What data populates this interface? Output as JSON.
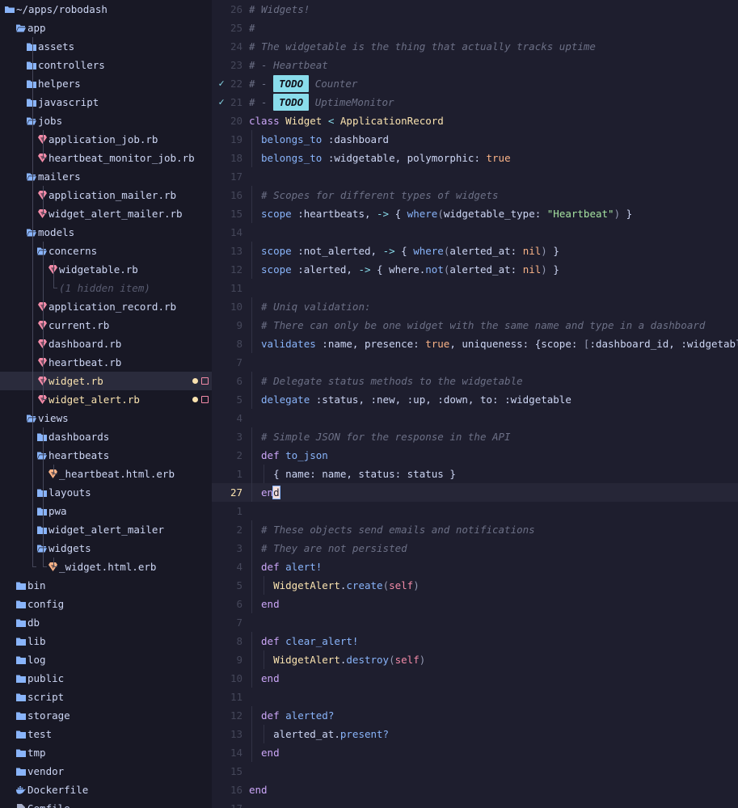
{
  "sidebar": {
    "root_label": "~/apps/robodash",
    "rows": [
      {
        "label": "app",
        "depth": 1,
        "kind": "folder-open"
      },
      {
        "label": "assets",
        "depth": 2,
        "kind": "folder"
      },
      {
        "label": "controllers",
        "depth": 2,
        "kind": "folder"
      },
      {
        "label": "helpers",
        "depth": 2,
        "kind": "folder"
      },
      {
        "label": "javascript",
        "depth": 2,
        "kind": "folder"
      },
      {
        "label": "jobs",
        "depth": 2,
        "kind": "folder-open"
      },
      {
        "label": "application_job.rb",
        "depth": 3,
        "kind": "ruby"
      },
      {
        "label": "heartbeat_monitor_job.rb",
        "depth": 3,
        "kind": "ruby"
      },
      {
        "label": "mailers",
        "depth": 2,
        "kind": "folder-open"
      },
      {
        "label": "application_mailer.rb",
        "depth": 3,
        "kind": "ruby"
      },
      {
        "label": "widget_alert_mailer.rb",
        "depth": 3,
        "kind": "ruby"
      },
      {
        "label": "models",
        "depth": 2,
        "kind": "folder-open"
      },
      {
        "label": "concerns",
        "depth": 3,
        "kind": "folder-open"
      },
      {
        "label": "widgetable.rb",
        "depth": 4,
        "kind": "ruby"
      },
      {
        "label": "(1 hidden item)",
        "depth": 4,
        "kind": "hidden"
      },
      {
        "label": "application_record.rb",
        "depth": 3,
        "kind": "ruby"
      },
      {
        "label": "current.rb",
        "depth": 3,
        "kind": "ruby"
      },
      {
        "label": "dashboard.rb",
        "depth": 3,
        "kind": "ruby"
      },
      {
        "label": "heartbeat.rb",
        "depth": 3,
        "kind": "ruby"
      },
      {
        "label": "widget.rb",
        "depth": 3,
        "kind": "ruby",
        "modified": true,
        "active": true
      },
      {
        "label": "widget_alert.rb",
        "depth": 3,
        "kind": "ruby",
        "modified": true
      },
      {
        "label": "views",
        "depth": 2,
        "kind": "folder-open"
      },
      {
        "label": "dashboards",
        "depth": 3,
        "kind": "folder"
      },
      {
        "label": "heartbeats",
        "depth": 3,
        "kind": "folder-open"
      },
      {
        "label": "_heartbeat.html.erb",
        "depth": 4,
        "kind": "erb"
      },
      {
        "label": "layouts",
        "depth": 3,
        "kind": "folder"
      },
      {
        "label": "pwa",
        "depth": 3,
        "kind": "folder"
      },
      {
        "label": "widget_alert_mailer",
        "depth": 3,
        "kind": "folder"
      },
      {
        "label": "widgets",
        "depth": 3,
        "kind": "folder-open"
      },
      {
        "label": "_widget.html.erb",
        "depth": 4,
        "kind": "erb"
      },
      {
        "label": "bin",
        "depth": 1,
        "kind": "folder"
      },
      {
        "label": "config",
        "depth": 1,
        "kind": "folder"
      },
      {
        "label": "db",
        "depth": 1,
        "kind": "folder"
      },
      {
        "label": "lib",
        "depth": 1,
        "kind": "folder"
      },
      {
        "label": "log",
        "depth": 1,
        "kind": "folder"
      },
      {
        "label": "public",
        "depth": 1,
        "kind": "folder"
      },
      {
        "label": "script",
        "depth": 1,
        "kind": "folder"
      },
      {
        "label": "storage",
        "depth": 1,
        "kind": "folder"
      },
      {
        "label": "test",
        "depth": 1,
        "kind": "folder"
      },
      {
        "label": "tmp",
        "depth": 1,
        "kind": "folder"
      },
      {
        "label": "vendor",
        "depth": 1,
        "kind": "folder"
      },
      {
        "label": "Dockerfile",
        "depth": 1,
        "kind": "docker"
      },
      {
        "label": "Gemfile",
        "depth": 1,
        "kind": "file"
      }
    ]
  },
  "editor": {
    "lines": [
      {
        "num": "26",
        "indent": 0,
        "tokens": [
          [
            "comment",
            "# Widgets!"
          ]
        ]
      },
      {
        "num": "25",
        "indent": 0,
        "tokens": [
          [
            "comment",
            "#"
          ]
        ]
      },
      {
        "num": "24",
        "indent": 0,
        "tokens": [
          [
            "comment",
            "# The widgetable is the thing that actually tracks uptime"
          ]
        ]
      },
      {
        "num": "23",
        "indent": 0,
        "tokens": [
          [
            "comment",
            "# - Heartbeat"
          ]
        ]
      },
      {
        "num": "22",
        "indent": 0,
        "sign": "✓",
        "tokens": [
          [
            "comment",
            "# - "
          ],
          [
            "todo",
            "TODO"
          ],
          [
            "comment",
            " Counter"
          ]
        ]
      },
      {
        "num": "21",
        "indent": 0,
        "sign": "✓",
        "tokens": [
          [
            "comment",
            "# - "
          ],
          [
            "todo",
            "TODO"
          ],
          [
            "comment",
            " UptimeMonitor"
          ]
        ]
      },
      {
        "num": "20",
        "indent": 0,
        "tokens": [
          [
            "keyword",
            "class "
          ],
          [
            "const",
            "Widget"
          ],
          [
            "op",
            " < "
          ],
          [
            "const",
            "ApplicationRecord"
          ]
        ]
      },
      {
        "num": "19",
        "indent": 1,
        "tokens": [
          [
            "method",
            "belongs_to"
          ],
          [
            "plain",
            " :dashboard"
          ]
        ]
      },
      {
        "num": "18",
        "indent": 1,
        "tokens": [
          [
            "method",
            "belongs_to"
          ],
          [
            "plain",
            " :widgetable, polymorphic: "
          ],
          [
            "bool",
            "true"
          ]
        ]
      },
      {
        "num": "17",
        "indent": 0,
        "tokens": []
      },
      {
        "num": "16",
        "indent": 1,
        "tokens": [
          [
            "comment",
            "# Scopes for different types of widgets"
          ]
        ]
      },
      {
        "num": "15",
        "indent": 1,
        "tokens": [
          [
            "method",
            "scope"
          ],
          [
            "plain",
            " :heartbeats, "
          ],
          [
            "op",
            "->"
          ],
          [
            "plain",
            " { "
          ],
          [
            "method",
            "where"
          ],
          [
            "brace",
            "("
          ],
          [
            "plain",
            "widgetable_type: "
          ],
          [
            "string",
            "\"Heartbeat\""
          ],
          [
            "brace",
            ")"
          ],
          [
            "plain",
            " }"
          ]
        ]
      },
      {
        "num": "14",
        "indent": 0,
        "tokens": []
      },
      {
        "num": "13",
        "indent": 1,
        "tokens": [
          [
            "method",
            "scope"
          ],
          [
            "plain",
            " :not_alerted, "
          ],
          [
            "op",
            "->"
          ],
          [
            "plain",
            " { "
          ],
          [
            "method",
            "where"
          ],
          [
            "brace",
            "("
          ],
          [
            "plain",
            "alerted_at: "
          ],
          [
            "bool",
            "nil"
          ],
          [
            "brace",
            ")"
          ],
          [
            "plain",
            " }"
          ]
        ]
      },
      {
        "num": "12",
        "indent": 1,
        "tokens": [
          [
            "method",
            "scope"
          ],
          [
            "plain",
            " :alerted, "
          ],
          [
            "op",
            "->"
          ],
          [
            "plain",
            " { where."
          ],
          [
            "method",
            "not"
          ],
          [
            "brace",
            "("
          ],
          [
            "plain",
            "alerted_at: "
          ],
          [
            "bool",
            "nil"
          ],
          [
            "brace",
            ")"
          ],
          [
            "plain",
            " }"
          ]
        ]
      },
      {
        "num": "11",
        "indent": 0,
        "tokens": []
      },
      {
        "num": "10",
        "indent": 1,
        "tokens": [
          [
            "comment",
            "# Uniq validation:"
          ]
        ]
      },
      {
        "num": "9",
        "indent": 1,
        "tokens": [
          [
            "comment",
            "# There can only be one widget with the same name and type in a dashboard"
          ]
        ]
      },
      {
        "num": "8",
        "indent": 1,
        "tokens": [
          [
            "method",
            "validates"
          ],
          [
            "plain",
            " :name, presence: "
          ],
          [
            "bool",
            "true"
          ],
          [
            "plain",
            ", uniqueness: {scope: "
          ],
          [
            "brace",
            "["
          ],
          [
            "plain",
            ":dashboard_id, :widgetable_type"
          ],
          [
            "brace",
            "]"
          ],
          [
            "plain",
            "}"
          ]
        ]
      },
      {
        "num": "7",
        "indent": 0,
        "tokens": []
      },
      {
        "num": "6",
        "indent": 1,
        "tokens": [
          [
            "comment",
            "# Delegate status methods to the widgetable"
          ]
        ]
      },
      {
        "num": "5",
        "indent": 1,
        "tokens": [
          [
            "method",
            "delegate"
          ],
          [
            "plain",
            " :status, :new, :up, :down, to: :widgetable"
          ]
        ]
      },
      {
        "num": "4",
        "indent": 0,
        "tokens": []
      },
      {
        "num": "3",
        "indent": 1,
        "tokens": [
          [
            "comment",
            "# Simple JSON for the response in the API"
          ]
        ]
      },
      {
        "num": "2",
        "indent": 1,
        "tokens": [
          [
            "keyword",
            "def "
          ],
          [
            "method",
            "to_json"
          ]
        ]
      },
      {
        "num": "1",
        "indent": 2,
        "tokens": [
          [
            "plain",
            "{ name: name, status: status }"
          ]
        ]
      },
      {
        "num": "27",
        "indent": 1,
        "current": true,
        "tokens": [
          [
            "keyword",
            "en"
          ],
          [
            "cursor",
            "d"
          ]
        ]
      },
      {
        "num": "1",
        "indent": 0,
        "tokens": []
      },
      {
        "num": "2",
        "indent": 1,
        "tokens": [
          [
            "comment",
            "# These objects send emails and notifications"
          ]
        ]
      },
      {
        "num": "3",
        "indent": 1,
        "tokens": [
          [
            "comment",
            "# They are not persisted"
          ]
        ]
      },
      {
        "num": "4",
        "indent": 1,
        "tokens": [
          [
            "keyword",
            "def "
          ],
          [
            "method",
            "alert!"
          ]
        ]
      },
      {
        "num": "5",
        "indent": 2,
        "tokens": [
          [
            "const",
            "WidgetAlert"
          ],
          [
            "plain",
            "."
          ],
          [
            "method",
            "create"
          ],
          [
            "brace",
            "("
          ],
          [
            "self",
            "self"
          ],
          [
            "brace",
            ")"
          ]
        ]
      },
      {
        "num": "6",
        "indent": 1,
        "tokens": [
          [
            "keyword",
            "end"
          ]
        ]
      },
      {
        "num": "7",
        "indent": 0,
        "tokens": []
      },
      {
        "num": "8",
        "indent": 1,
        "tokens": [
          [
            "keyword",
            "def "
          ],
          [
            "method",
            "clear_alert!"
          ]
        ]
      },
      {
        "num": "9",
        "indent": 2,
        "tokens": [
          [
            "const",
            "WidgetAlert"
          ],
          [
            "plain",
            "."
          ],
          [
            "method",
            "destroy"
          ],
          [
            "brace",
            "("
          ],
          [
            "self",
            "self"
          ],
          [
            "brace",
            ")"
          ]
        ]
      },
      {
        "num": "10",
        "indent": 1,
        "tokens": [
          [
            "keyword",
            "end"
          ]
        ]
      },
      {
        "num": "11",
        "indent": 0,
        "tokens": []
      },
      {
        "num": "12",
        "indent": 1,
        "tokens": [
          [
            "keyword",
            "def "
          ],
          [
            "method",
            "alerted?"
          ]
        ]
      },
      {
        "num": "13",
        "indent": 2,
        "tokens": [
          [
            "plain",
            "alerted_at."
          ],
          [
            "method",
            "present?"
          ]
        ]
      },
      {
        "num": "14",
        "indent": 1,
        "tokens": [
          [
            "keyword",
            "end"
          ]
        ]
      },
      {
        "num": "15",
        "indent": 0,
        "tokens": []
      },
      {
        "num": "16",
        "indent": 0,
        "tokens": [
          [
            "keyword",
            "end"
          ]
        ]
      },
      {
        "num": "17",
        "indent": 0,
        "tokens": []
      }
    ]
  }
}
